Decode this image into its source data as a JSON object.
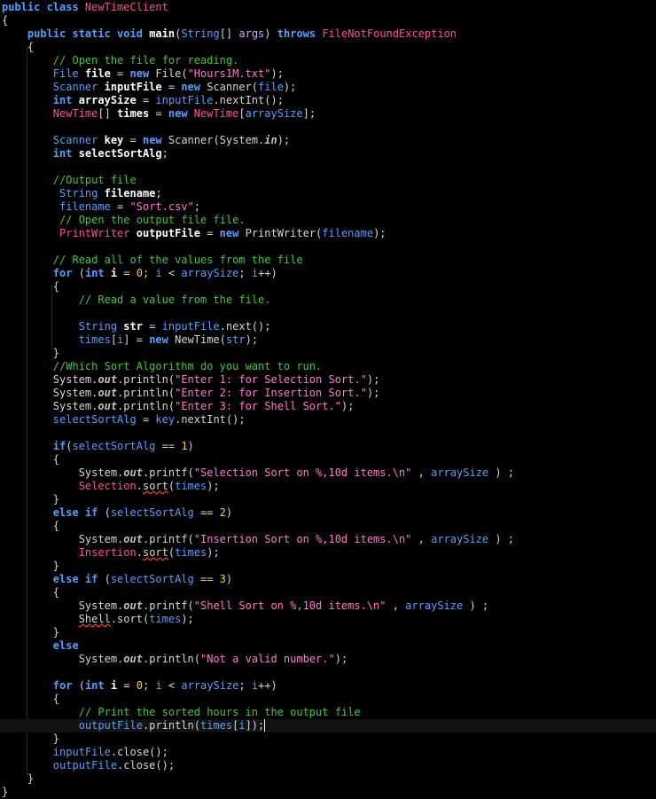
{
  "colors": {
    "background": "#000000",
    "keyword": "#52a0ff",
    "comment": "#3ec93a",
    "string": "#ff79cf",
    "number": "#ffd400",
    "class_name": "#ff4f93",
    "parameter": "#c9a6ff",
    "text": "#d6d6d6"
  },
  "editor": {
    "current_line": 54,
    "lines": [
      [
        [
          "kw",
          "public class "
        ],
        [
          "id",
          "NewTimeClient"
        ]
      ],
      [
        [
          "pl",
          "{"
        ]
      ],
      [
        [
          "pl",
          "    "
        ],
        [
          "kw",
          "public static void "
        ],
        [
          "vr",
          "main"
        ],
        [
          "pl",
          "("
        ],
        [
          "ty",
          "String"
        ],
        [
          "pl",
          "[] "
        ],
        [
          "pa",
          "args"
        ],
        [
          "pl",
          ") "
        ],
        [
          "kw",
          "throws "
        ],
        [
          "id",
          "FileNotFoundException"
        ]
      ],
      [
        [
          "pl",
          "    {"
        ]
      ],
      [
        [
          "pl",
          "        "
        ],
        [
          "cm",
          "// Open the file for reading."
        ]
      ],
      [
        [
          "pl",
          "        "
        ],
        [
          "ty",
          "File "
        ],
        [
          "vr",
          "file"
        ],
        [
          "pl",
          " = "
        ],
        [
          "kw",
          "new "
        ],
        [
          "pl",
          "File("
        ],
        [
          "st",
          "\"Hours1M.txt\""
        ],
        [
          "pl",
          ");"
        ]
      ],
      [
        [
          "pl",
          "        "
        ],
        [
          "ty",
          "Scanner "
        ],
        [
          "vr",
          "inputFile"
        ],
        [
          "pl",
          " = "
        ],
        [
          "kw",
          "new "
        ],
        [
          "pl",
          "Scanner("
        ],
        [
          "ty",
          "file"
        ],
        [
          "pl",
          ");"
        ]
      ],
      [
        [
          "pl",
          "        "
        ],
        [
          "kw",
          "int "
        ],
        [
          "vr",
          "arraySize"
        ],
        [
          "pl",
          " = "
        ],
        [
          "ty",
          "inputFile"
        ],
        [
          "pl",
          ".nextInt();"
        ]
      ],
      [
        [
          "pl",
          "        "
        ],
        [
          "id",
          "NewTime"
        ],
        [
          "pl",
          "[] "
        ],
        [
          "vr",
          "times"
        ],
        [
          "pl",
          " = "
        ],
        [
          "kw",
          "new "
        ],
        [
          "id",
          "NewTime"
        ],
        [
          "pl",
          "["
        ],
        [
          "ty",
          "arraySize"
        ],
        [
          "pl",
          "];"
        ]
      ],
      [
        [
          "pl",
          ""
        ]
      ],
      [
        [
          "pl",
          "        "
        ],
        [
          "ty",
          "Scanner "
        ],
        [
          "vr",
          "key"
        ],
        [
          "pl",
          " = "
        ],
        [
          "kw",
          "new "
        ],
        [
          "pl",
          "Scanner(System."
        ],
        [
          "fd",
          "in"
        ],
        [
          "pl",
          ");"
        ]
      ],
      [
        [
          "pl",
          "        "
        ],
        [
          "kw",
          "int "
        ],
        [
          "vr",
          "selectSortAlg"
        ],
        [
          "pl",
          ";"
        ]
      ],
      [
        [
          "pl",
          ""
        ]
      ],
      [
        [
          "pl",
          "        "
        ],
        [
          "cm",
          "//Output file"
        ]
      ],
      [
        [
          "pl",
          "         "
        ],
        [
          "ty",
          "String "
        ],
        [
          "vr",
          "filename"
        ],
        [
          "pl",
          ";"
        ]
      ],
      [
        [
          "pl",
          "         "
        ],
        [
          "ty",
          "filename"
        ],
        [
          "pl",
          " = "
        ],
        [
          "st",
          "\"Sort.csv\""
        ],
        [
          "pl",
          ";"
        ]
      ],
      [
        [
          "pl",
          "         "
        ],
        [
          "cm",
          "// Open the output file file."
        ]
      ],
      [
        [
          "pl",
          "         "
        ],
        [
          "id",
          "PrintWriter "
        ],
        [
          "vr",
          "outputFile"
        ],
        [
          "pl",
          " = "
        ],
        [
          "kw",
          "new "
        ],
        [
          "pl",
          "PrintWriter("
        ],
        [
          "ty",
          "filename"
        ],
        [
          "pl",
          ");"
        ]
      ],
      [
        [
          "pl",
          ""
        ]
      ],
      [
        [
          "pl",
          "        "
        ],
        [
          "cm",
          "// Read all of the values from the file"
        ]
      ],
      [
        [
          "pl",
          "        "
        ],
        [
          "kw",
          "for "
        ],
        [
          "pl",
          "("
        ],
        [
          "kw",
          "int "
        ],
        [
          "vr",
          "i"
        ],
        [
          "pl",
          " = "
        ],
        [
          "nu",
          "0"
        ],
        [
          "pl",
          "; "
        ],
        [
          "ty",
          "i"
        ],
        [
          "pl",
          " < "
        ],
        [
          "ty",
          "arraySize"
        ],
        [
          "pl",
          "; "
        ],
        [
          "ty",
          "i"
        ],
        [
          "pl",
          "++)"
        ]
      ],
      [
        [
          "pl",
          "        {"
        ]
      ],
      [
        [
          "pl",
          "            "
        ],
        [
          "cm",
          "// Read a value from the file."
        ]
      ],
      [
        [
          "pl",
          ""
        ]
      ],
      [
        [
          "pl",
          "            "
        ],
        [
          "ty",
          "String "
        ],
        [
          "vr",
          "str"
        ],
        [
          "pl",
          " = "
        ],
        [
          "ty",
          "inputFile"
        ],
        [
          "pl",
          ".next();"
        ]
      ],
      [
        [
          "pl",
          "            "
        ],
        [
          "ty",
          "times"
        ],
        [
          "pl",
          "["
        ],
        [
          "ty",
          "i"
        ],
        [
          "pl",
          "] = "
        ],
        [
          "kw",
          "new "
        ],
        [
          "pl",
          "NewTime("
        ],
        [
          "ty",
          "str"
        ],
        [
          "pl",
          ");"
        ]
      ],
      [
        [
          "pl",
          "        }"
        ]
      ],
      [
        [
          "pl",
          "        "
        ],
        [
          "cm",
          "//Which Sort Algorithm do you want to run."
        ]
      ],
      [
        [
          "pl",
          "        System."
        ],
        [
          "fd",
          "out"
        ],
        [
          "pl",
          ".println("
        ],
        [
          "st",
          "\"Enter 1: for Selection Sort.\""
        ],
        [
          "pl",
          ");"
        ]
      ],
      [
        [
          "pl",
          "        System."
        ],
        [
          "fd",
          "out"
        ],
        [
          "pl",
          ".println("
        ],
        [
          "st",
          "\"Enter 2: for Insertion Sort.\""
        ],
        [
          "pl",
          ");"
        ]
      ],
      [
        [
          "pl",
          "        System."
        ],
        [
          "fd",
          "out"
        ],
        [
          "pl",
          ".println("
        ],
        [
          "st",
          "\"Enter 3: for Shell Sort.\""
        ],
        [
          "pl",
          ");"
        ]
      ],
      [
        [
          "pl",
          "        "
        ],
        [
          "ty",
          "selectSortAlg"
        ],
        [
          "pl",
          " = "
        ],
        [
          "ty",
          "key"
        ],
        [
          "pl",
          ".nextInt();"
        ]
      ],
      [
        [
          "pl",
          ""
        ]
      ],
      [
        [
          "pl",
          "        "
        ],
        [
          "kw",
          "if"
        ],
        [
          "pl",
          "("
        ],
        [
          "ty",
          "selectSortAlg"
        ],
        [
          "pl",
          " == "
        ],
        [
          "nu",
          "1"
        ],
        [
          "pl",
          ")"
        ]
      ],
      [
        [
          "pl",
          "        {"
        ]
      ],
      [
        [
          "pl",
          "            System."
        ],
        [
          "fd",
          "out"
        ],
        [
          "pl",
          ".printf("
        ],
        [
          "st",
          "\"Selection Sort on %,10d items.\\n\""
        ],
        [
          "pl",
          " , "
        ],
        [
          "ty",
          "arraySize"
        ],
        [
          "pl",
          " ) ;"
        ]
      ],
      [
        [
          "pl",
          "            "
        ],
        [
          "id",
          "Selection"
        ],
        [
          "pl",
          "."
        ],
        [
          "sq",
          "sort"
        ],
        [
          "pl",
          "("
        ],
        [
          "ty",
          "times"
        ],
        [
          "pl",
          ");"
        ]
      ],
      [
        [
          "pl",
          "        }"
        ]
      ],
      [
        [
          "pl",
          "        "
        ],
        [
          "kw",
          "else if "
        ],
        [
          "pl",
          "("
        ],
        [
          "ty",
          "selectSortAlg"
        ],
        [
          "pl",
          " == "
        ],
        [
          "nu",
          "2"
        ],
        [
          "pl",
          ")"
        ]
      ],
      [
        [
          "pl",
          "        {"
        ]
      ],
      [
        [
          "pl",
          "            System."
        ],
        [
          "fd",
          "out"
        ],
        [
          "pl",
          ".printf("
        ],
        [
          "st",
          "\"Insertion Sort on %,10d items.\\n\""
        ],
        [
          "pl",
          " , "
        ],
        [
          "ty",
          "arraySize"
        ],
        [
          "pl",
          " ) ;"
        ]
      ],
      [
        [
          "pl",
          "            "
        ],
        [
          "id",
          "Insertion"
        ],
        [
          "pl",
          "."
        ],
        [
          "sq",
          "sort"
        ],
        [
          "pl",
          "("
        ],
        [
          "ty",
          "times"
        ],
        [
          "pl",
          ");"
        ]
      ],
      [
        [
          "pl",
          "        }"
        ]
      ],
      [
        [
          "pl",
          "        "
        ],
        [
          "kw",
          "else if "
        ],
        [
          "pl",
          "("
        ],
        [
          "ty",
          "selectSortAlg"
        ],
        [
          "pl",
          " == "
        ],
        [
          "nu",
          "3"
        ],
        [
          "pl",
          ")"
        ]
      ],
      [
        [
          "pl",
          "        {"
        ]
      ],
      [
        [
          "pl",
          "            System."
        ],
        [
          "fd",
          "out"
        ],
        [
          "pl",
          ".printf("
        ],
        [
          "st",
          "\"Shell Sort on %,10d items.\\n\""
        ],
        [
          "pl",
          " , "
        ],
        [
          "ty",
          "arraySize"
        ],
        [
          "pl",
          " ) ;"
        ]
      ],
      [
        [
          "pl",
          "            "
        ],
        [
          "sq",
          "Shell"
        ],
        [
          "pl",
          ".sort("
        ],
        [
          "ty",
          "times"
        ],
        [
          "pl",
          ");"
        ]
      ],
      [
        [
          "pl",
          "        }"
        ]
      ],
      [
        [
          "pl",
          "        "
        ],
        [
          "kw",
          "else"
        ]
      ],
      [
        [
          "pl",
          "            System."
        ],
        [
          "fd",
          "out"
        ],
        [
          "pl",
          ".println("
        ],
        [
          "st",
          "\"Not a valid number.\""
        ],
        [
          "pl",
          ");"
        ]
      ],
      [
        [
          "pl",
          ""
        ]
      ],
      [
        [
          "pl",
          "        "
        ],
        [
          "kw",
          "for "
        ],
        [
          "pl",
          "("
        ],
        [
          "kw",
          "int "
        ],
        [
          "vr",
          "i"
        ],
        [
          "pl",
          " = "
        ],
        [
          "nu",
          "0"
        ],
        [
          "pl",
          "; "
        ],
        [
          "ty",
          "i"
        ],
        [
          "pl",
          " < "
        ],
        [
          "ty",
          "arraySize"
        ],
        [
          "pl",
          "; "
        ],
        [
          "ty",
          "i"
        ],
        [
          "pl",
          "++)"
        ]
      ],
      [
        [
          "pl",
          "        {"
        ]
      ],
      [
        [
          "pl",
          "            "
        ],
        [
          "cm",
          "// Print the sorted hours in the output file"
        ]
      ],
      [
        [
          "pl",
          "            "
        ],
        [
          "ty",
          "outputFile"
        ],
        [
          "pl",
          ".println("
        ],
        [
          "ty",
          "times"
        ],
        [
          "pl",
          "["
        ],
        [
          "ty",
          "i"
        ],
        [
          "pl",
          "]);"
        ]
      ],
      [
        [
          "pl",
          "        }"
        ]
      ],
      [
        [
          "pl",
          "        "
        ],
        [
          "ty",
          "inputFile"
        ],
        [
          "pl",
          ".close();"
        ]
      ],
      [
        [
          "pl",
          "        "
        ],
        [
          "ty",
          "outputFile"
        ],
        [
          "pl",
          ".close();"
        ]
      ],
      [
        [
          "pl",
          "    }"
        ]
      ],
      [
        [
          "pl",
          "}"
        ]
      ]
    ]
  }
}
